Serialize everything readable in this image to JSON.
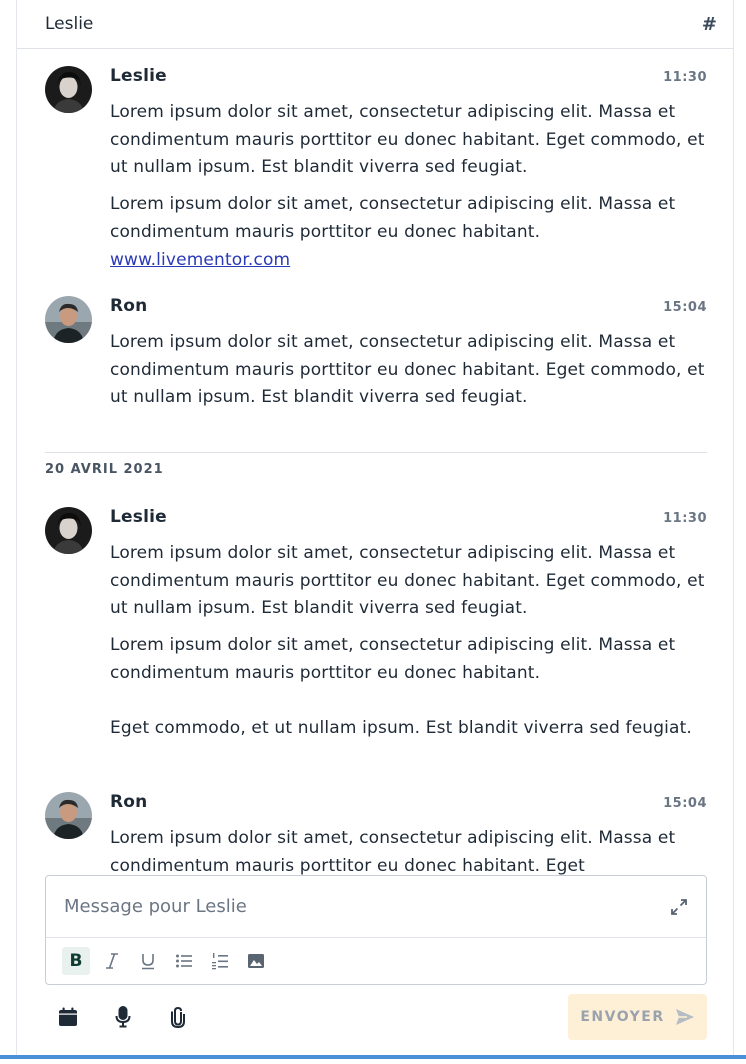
{
  "header": {
    "title": "Leslie",
    "channel_icon": "hash-icon"
  },
  "messages": [
    {
      "author": "Leslie",
      "time": "11:30",
      "avatar": "avatar-leslie",
      "paragraphs": [
        "Lorem ipsum dolor sit amet, consectetur adipiscing elit. Massa et condimentum mauris porttitor eu donec habitant. Eget commodo, et ut nullam ipsum. Est blandit viverra sed feugiat.",
        "Lorem ipsum dolor sit amet, consectetur adipiscing elit. Massa et condimentum mauris porttitor eu donec habitant."
      ],
      "link": "www.livementor.com"
    },
    {
      "author": "Ron",
      "time": "15:04",
      "avatar": "avatar-ron",
      "paragraphs": [
        "Lorem ipsum dolor sit amet, consectetur adipiscing elit. Massa et condimentum mauris porttitor eu donec habitant. Eget commodo, et ut nullam ipsum. Est blandit viverra sed feugiat."
      ]
    },
    {
      "author": "Leslie",
      "time": "11:30",
      "avatar": "avatar-leslie",
      "paragraphs": [
        "Lorem ipsum dolor sit amet, consectetur adipiscing elit. Massa et condimentum mauris porttitor eu donec habitant. Eget commodo, et ut nullam ipsum. Est blandit viverra sed feugiat.",
        "Lorem ipsum dolor sit amet, consectetur adipiscing elit. Massa et condimentum mauris porttitor eu donec habitant.",
        "Eget commodo, et ut nullam ipsum. Est blandit viverra sed feugiat."
      ]
    },
    {
      "author": "Ron",
      "time": "15:04",
      "avatar": "avatar-ron",
      "paragraphs": [
        "Lorem ipsum dolor sit amet, consectetur adipiscing elit. Massa et condimentum mauris porttitor eu donec habitant. Eget"
      ]
    }
  ],
  "date_separator": "20 AVRIL 2021",
  "composer": {
    "placeholder": "Message pour Leslie",
    "tools": [
      "bold-icon",
      "italic-icon",
      "underline-icon",
      "bullet-list-icon",
      "numbered-list-icon",
      "image-icon"
    ],
    "bold_label": "B"
  },
  "actions": {
    "icons": [
      "calendar-icon",
      "microphone-icon",
      "attachment-icon"
    ],
    "send_label": "ENVOYER"
  },
  "colors": {
    "accent": "#4a90d9",
    "send_bg": "#fdf0d6",
    "link": "#2a39b6"
  }
}
